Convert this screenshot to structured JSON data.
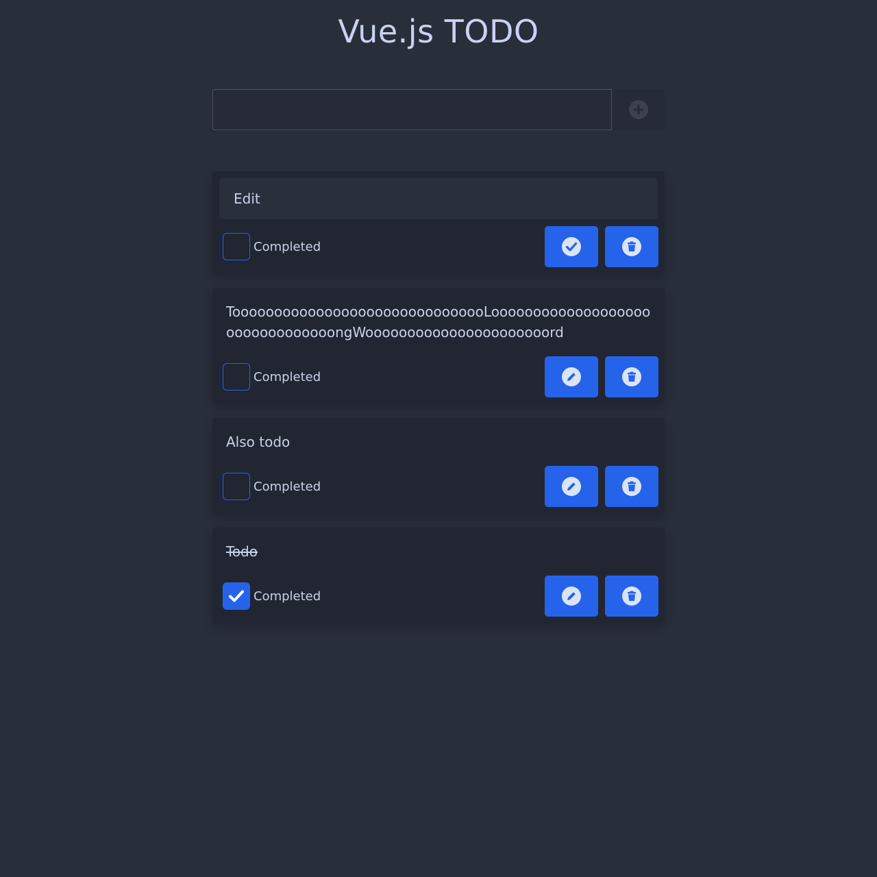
{
  "app": {
    "title": "Vue.js TODO"
  },
  "new_todo": {
    "value": "",
    "placeholder": "",
    "add_icon": "plus-circle-icon"
  },
  "todos": [
    {
      "text": "Edit",
      "editing": true,
      "completed": false,
      "completed_label": "Completed",
      "primary_icon": "check-circle-icon",
      "delete_icon": "trash-circle-icon"
    },
    {
      "text": "TooooooooooooooooooooooooooooooLoooooooooooooooooooooooooooooooongWoooooooooooooooooooooord",
      "editing": false,
      "completed": false,
      "completed_label": "Completed",
      "primary_icon": "pencil-circle-icon",
      "delete_icon": "trash-circle-icon"
    },
    {
      "text": "Also todo",
      "editing": false,
      "completed": false,
      "completed_label": "Completed",
      "primary_icon": "pencil-circle-icon",
      "delete_icon": "trash-circle-icon"
    },
    {
      "text": "Todo",
      "editing": false,
      "completed": true,
      "completed_label": "Completed",
      "primary_icon": "pencil-circle-icon",
      "delete_icon": "trash-circle-icon"
    }
  ],
  "colors": {
    "background": "#292e3b",
    "card": "#222632",
    "accent": "#2563eb",
    "text": "#c8d2ea"
  }
}
